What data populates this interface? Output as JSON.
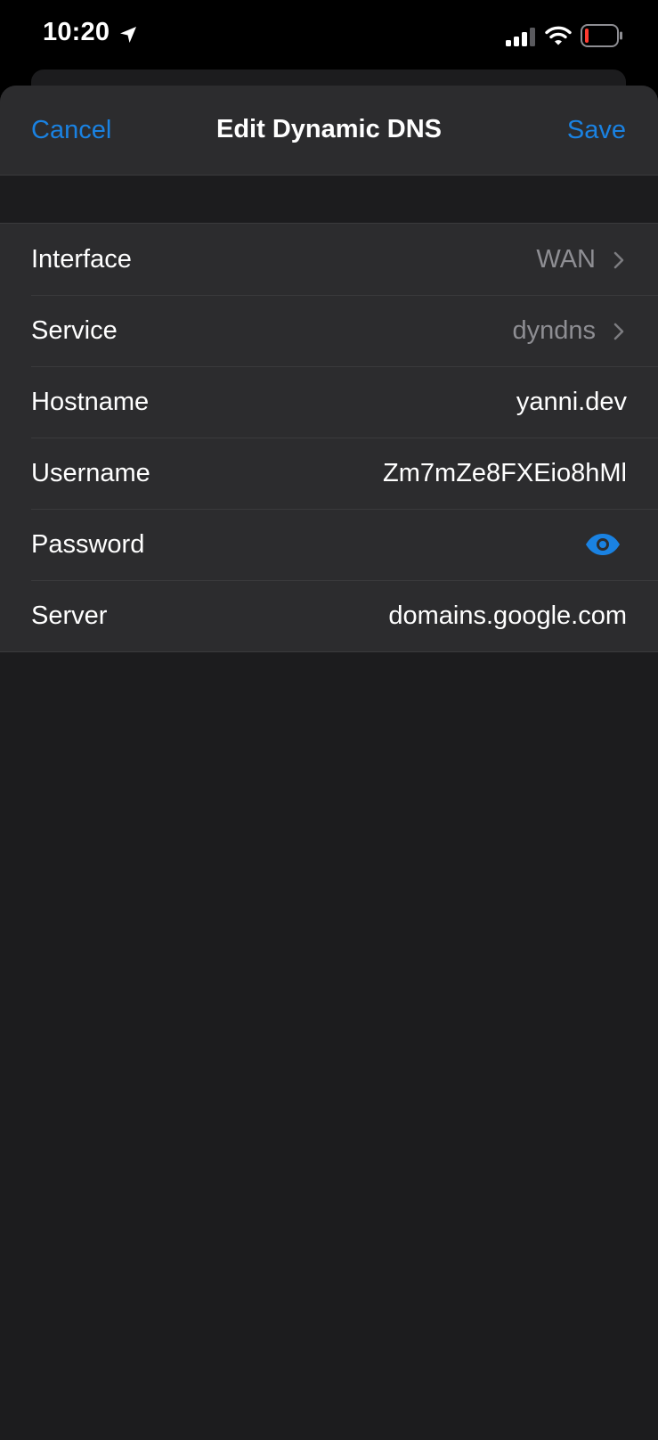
{
  "status_bar": {
    "time": "10:20",
    "icons": [
      "location-arrow-icon",
      "cellular-signal-icon",
      "wifi-icon",
      "battery-low-icon"
    ]
  },
  "nav": {
    "cancel_label": "Cancel",
    "title": "Edit Dynamic DNS",
    "save_label": "Save"
  },
  "form": {
    "rows": [
      {
        "label": "Interface",
        "value": "WAN",
        "type": "picker"
      },
      {
        "label": "Service",
        "value": "dyndns",
        "type": "picker"
      },
      {
        "label": "Hostname",
        "value": "yanni.dev",
        "type": "text"
      },
      {
        "label": "Username",
        "value": "Zm7mZe8FXEio8hMl",
        "type": "text"
      },
      {
        "label": "Password",
        "value": "",
        "type": "secure",
        "icon": "eye-icon"
      },
      {
        "label": "Server",
        "value": "domains.google.com",
        "type": "text"
      }
    ]
  },
  "colors": {
    "accent": "#1a82e2",
    "background": "#1c1c1e",
    "cell": "#2c2c2e",
    "secondary_text": "#8e8e93",
    "battery_low": "#ff3b30"
  }
}
